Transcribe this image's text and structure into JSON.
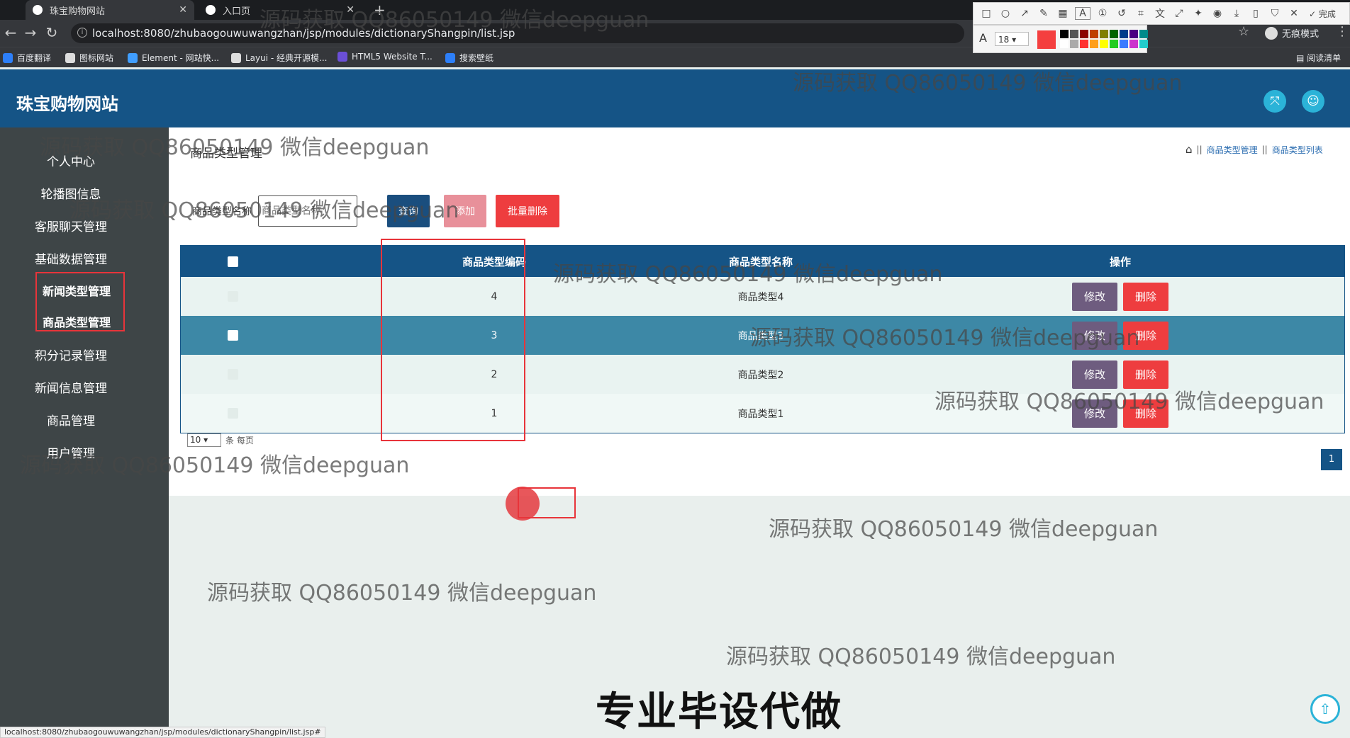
{
  "browser": {
    "tabs": [
      {
        "label": "珠宝购物网站",
        "active": true
      },
      {
        "label": "入口页",
        "active": false
      }
    ],
    "url": "localhost:8080/zhubaogouwuwangzhan/jsp/modules/dictionaryShangpin/list.jsp",
    "incognito_label": "无痕模式",
    "reading_list_label": "阅读清单",
    "bookmarks": [
      {
        "label": "百度翻译",
        "icon": "baidu-translate-icon",
        "color": "#2d7ff9"
      },
      {
        "label": "图标网站",
        "icon": "flag-icon",
        "color": "#dddddd"
      },
      {
        "label": "Element - 网站快...",
        "icon": "element-icon",
        "color": "#409eff"
      },
      {
        "label": "Layui - 经典开源模...",
        "icon": "layui-icon",
        "color": "#dddddd"
      },
      {
        "label": "HTML5 Website T...",
        "icon": "html5-icon",
        "color": "#6b4fd8"
      },
      {
        "label": "搜索壁纸",
        "icon": "wallpaper-icon",
        "color": "#2d7ff9"
      }
    ],
    "status_url": "localhost:8080/zhubaogouwuwangzhan/jsp/modules/dictionaryShangpin/list.jsp#"
  },
  "annotation_toolbar": {
    "done_label": "完成",
    "font_size": "18",
    "current_color": "#f43f3f",
    "palette": [
      "#000000",
      "#555555",
      "#8b0000",
      "#c04000",
      "#808000",
      "#006400",
      "#003b8b",
      "#4b0082",
      "#008b8b",
      "#ffffff",
      "#aaaaaa",
      "#ff3030",
      "#ff9f1a",
      "#ffff00",
      "#22cc22",
      "#3b7bff",
      "#cc33cc",
      "#22cccc"
    ]
  },
  "header": {
    "site_title": "珠宝购物网站"
  },
  "sidebar": {
    "items": [
      {
        "label": "个人中心"
      },
      {
        "label": "轮播图信息"
      },
      {
        "label": "客服聊天管理"
      },
      {
        "label": "基础数据管理"
      },
      {
        "label": "新闻类型管理"
      },
      {
        "label": "商品类型管理"
      },
      {
        "label": "积分记录管理"
      },
      {
        "label": "新闻信息管理"
      },
      {
        "label": "商品管理"
      },
      {
        "label": "用户管理"
      }
    ]
  },
  "page": {
    "title": "商品类型管理",
    "breadcrumb": [
      "商品类型管理",
      "商品类型列表"
    ],
    "search": {
      "label": "商品类型名称",
      "placeholder": "商品类型名称"
    },
    "buttons": {
      "query": "查询",
      "add": "添加",
      "batch_delete": "批量删除"
    },
    "table": {
      "headers": {
        "code": "商品类型编码",
        "name": "商品类型名称",
        "operation": "操作"
      },
      "rows": [
        {
          "code": "4",
          "name": "商品类型4"
        },
        {
          "code": "3",
          "name": "商品类型3"
        },
        {
          "code": "2",
          "name": "商品类型2"
        },
        {
          "code": "1",
          "name": "商品类型1"
        }
      ],
      "edit_label": "修改",
      "delete_label": "删除"
    },
    "pager": {
      "page_size": "10",
      "per_page_label": "条 每页",
      "current_page": "1"
    }
  },
  "overlay": {
    "watermark": "源码获取 QQ86050149 微信deepguan",
    "banner": "专业毕设代做"
  }
}
